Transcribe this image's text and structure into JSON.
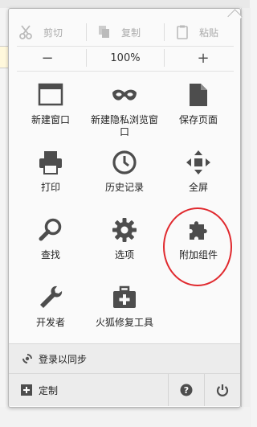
{
  "edit": {
    "cut_label": "剪切",
    "copy_label": "复制",
    "paste_label": "粘贴"
  },
  "zoom": {
    "minus": "−",
    "level": "100%",
    "plus": "+"
  },
  "menu": {
    "items": [
      {
        "label": "新建窗口",
        "icon": "new-window-icon"
      },
      {
        "label": "新建隐私浏览窗口",
        "icon": "private-mask-icon"
      },
      {
        "label": "保存页面",
        "icon": "save-page-icon"
      },
      {
        "label": "打印",
        "icon": "printer-icon"
      },
      {
        "label": "历史记录",
        "icon": "clock-icon"
      },
      {
        "label": "全屏",
        "icon": "fullscreen-icon"
      },
      {
        "label": "查找",
        "icon": "magnifier-icon"
      },
      {
        "label": "选项",
        "icon": "gear-icon"
      },
      {
        "label": "附加组件",
        "icon": "puzzle-icon"
      },
      {
        "label": "开发者",
        "icon": "wrench-icon"
      },
      {
        "label": "火狐修复工具",
        "icon": "toolbox-icon"
      }
    ]
  },
  "sync": {
    "label": "登录以同步"
  },
  "footer": {
    "customize_label": "定制"
  },
  "colors": {
    "icon": "#4d4d4d",
    "annotation": "#e0292e"
  }
}
